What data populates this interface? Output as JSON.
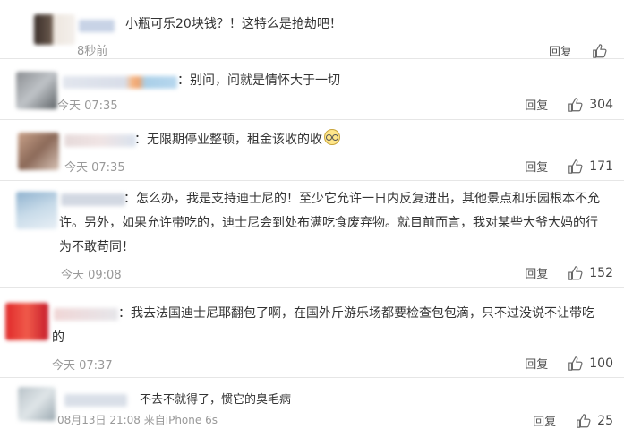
{
  "comments": [
    {
      "text": "小瓶可乐20块钱？！这特么是抢劫吧！",
      "time": "8秒前",
      "reply": "回复",
      "likes": ""
    },
    {
      "text": "：别问，问就是情怀大于一切",
      "time": "今天 07:35",
      "reply": "回复",
      "likes": "304"
    },
    {
      "text": "：无限期停业整顿，租金该收的收",
      "emoji": "face-emoji",
      "time": "今天 07:35",
      "reply": "回复",
      "likes": "171"
    },
    {
      "text_line1": "：怎么办，我是支持迪士尼的！至少它允许一日内反复进出，其他景点和乐园根本不允",
      "text_line2": "许。另外，如果允许带吃的，迪士尼会到处布满吃食废弃物。就目前而言，我对某些大爷大妈的行",
      "text_line3": "为不敢苟同！",
      "time": "今天 09:08",
      "reply": "回复",
      "likes": "152"
    },
    {
      "text_line1": "：我去法国迪士尼耶翻包了啊，在国外斤游乐场都要检查包包滴，只不过没说不让带吃",
      "text_line2": "的",
      "time": "今天 07:37",
      "reply": "回复",
      "likes": "100"
    },
    {
      "text": "不去不就得了，惯它的臭毛病",
      "time": "08月13日 21:08 来自iPhone 6s",
      "reply": "回复",
      "likes": "25"
    }
  ],
  "colors": {
    "text": "#333333",
    "meta": "#999999",
    "divider": "#e6e6e6"
  }
}
